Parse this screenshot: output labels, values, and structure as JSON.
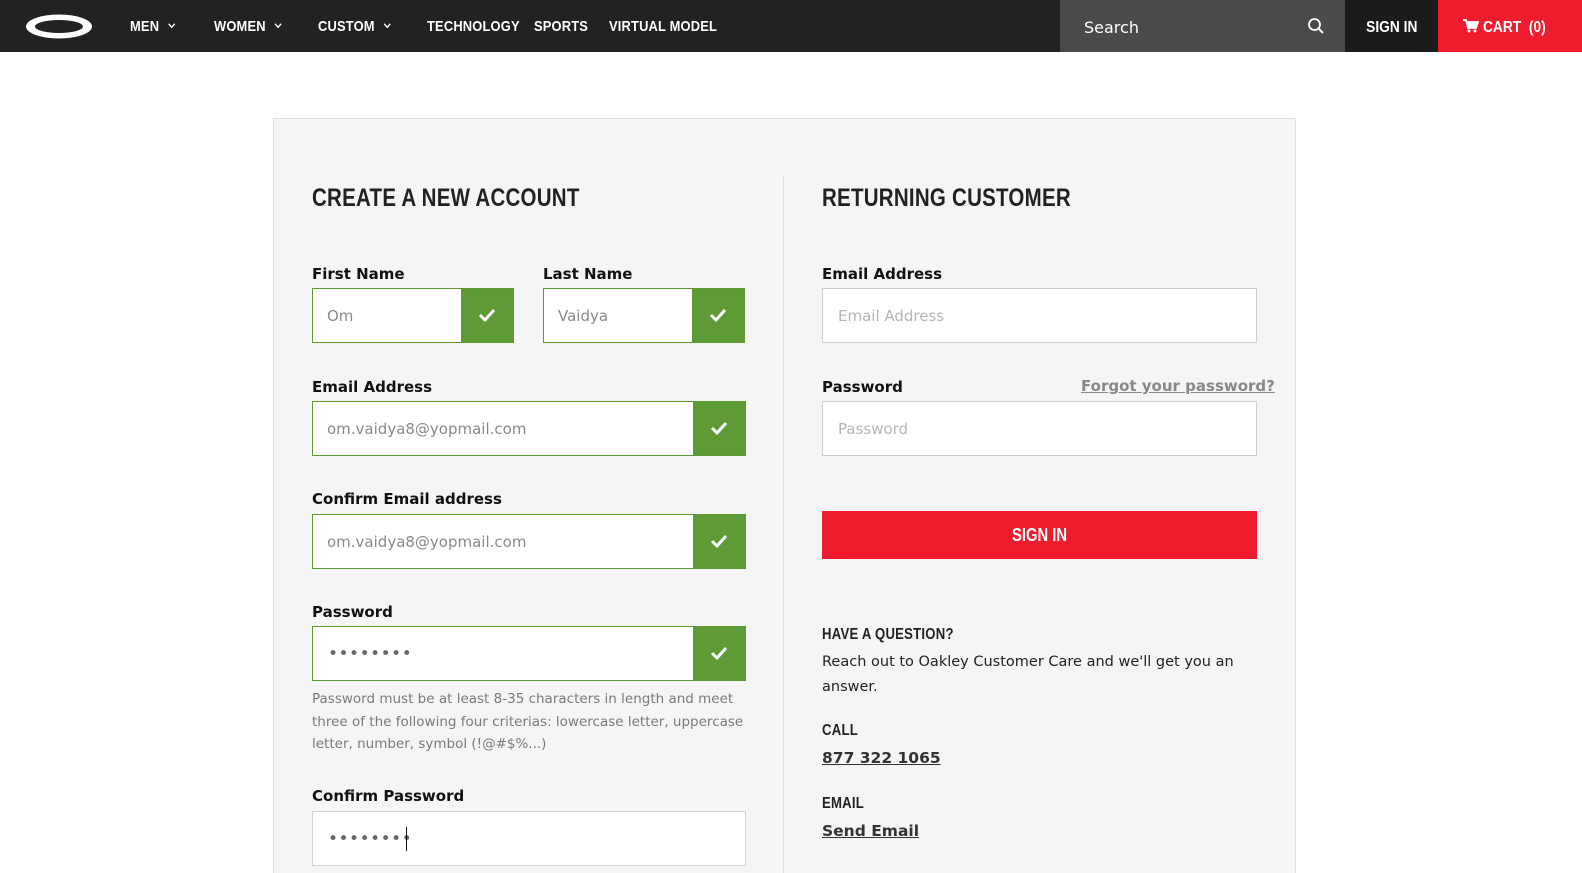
{
  "nav": {
    "items": [
      {
        "label": "MEN",
        "has_dropdown": true
      },
      {
        "label": "WOMEN",
        "has_dropdown": true
      },
      {
        "label": "CUSTOM",
        "has_dropdown": true
      },
      {
        "label": "TECHNOLOGY",
        "has_dropdown": false
      },
      {
        "label": "SPORTS",
        "has_dropdown": false
      },
      {
        "label": "VIRTUAL MODEL",
        "has_dropdown": false
      }
    ],
    "search_placeholder": "Search",
    "sign_in": "SIGN IN",
    "cart_label": "CART",
    "cart_count": "(0)",
    "logo_icon": "oakley-ellipse-logo",
    "accent_color": "#ee1c2e",
    "bar_color": "#222222"
  },
  "create": {
    "title": "CREATE A NEW ACCOUNT",
    "first_name_label": "First Name",
    "first_name_value": "Om",
    "last_name_label": "Last Name",
    "last_name_value": "Vaidya",
    "email_label": "Email Address",
    "email_value": "om.vaidya8@yopmail.com",
    "confirm_email_label": "Confirm Email address",
    "confirm_email_value": "om.vaidya8@yopmail.com",
    "password_label": "Password",
    "password_mask": "••••••••",
    "password_hint": "Password must be at least 8-35 characters in length and meet three of the following four criterias: lowercase letter, uppercase letter, number, symbol (!@#$%...)",
    "confirm_password_label": "Confirm Password",
    "confirm_password_mask": "••••••••",
    "valid_color": "#5e9a36"
  },
  "returning": {
    "title": "RETURNING CUSTOMER",
    "email_label": "Email Address",
    "email_placeholder": "Email Address",
    "password_label": "Password",
    "password_placeholder": "Password",
    "forgot_link": "Forgot your password?",
    "sign_in_button": "SIGN IN"
  },
  "help": {
    "heading": "HAVE A QUESTION?",
    "text": "Reach out to Oakley Customer Care and we'll get you an answer.",
    "call_heading": "CALL",
    "phone": "877 322 1065",
    "email_heading": "EMAIL",
    "email_link": "Send Email"
  }
}
